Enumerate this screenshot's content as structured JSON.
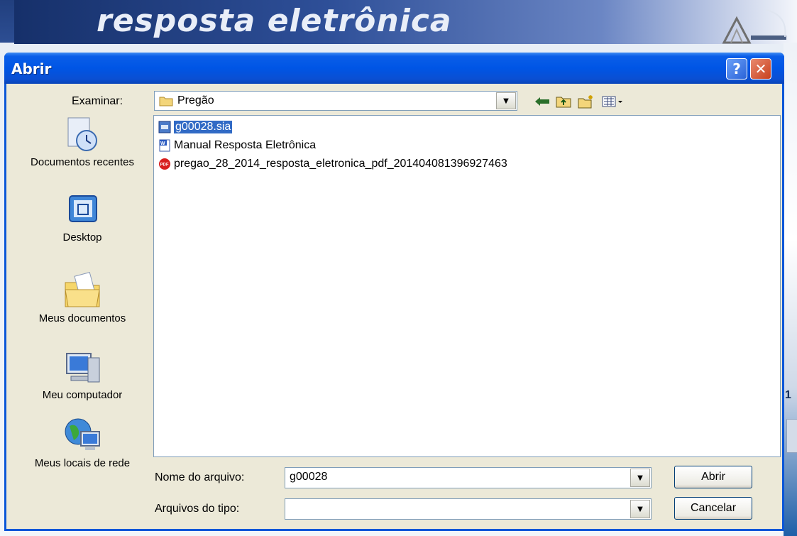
{
  "background": {
    "app_title": "resposta eletrônica",
    "right_label": "1"
  },
  "dialog": {
    "title": "Abrir",
    "help_label": "?",
    "close_label": "✕",
    "look_in_label": "Examinar:",
    "look_in_value": "Pregão",
    "toolbar_icons": [
      "back-arrow-icon",
      "up-folder-icon",
      "new-folder-icon",
      "view-menu-icon"
    ],
    "places": [
      {
        "label": "Documentos recentes",
        "icon": "recent-documents-icon"
      },
      {
        "label": "Desktop",
        "icon": "desktop-icon"
      },
      {
        "label": "Meus documentos",
        "icon": "my-documents-icon"
      },
      {
        "label": "Meu computador",
        "icon": "my-computer-icon"
      },
      {
        "label": "Meus locais de rede",
        "icon": "network-places-icon"
      }
    ],
    "files": [
      {
        "name": "g00028.sia",
        "icon": "sia-file-icon",
        "selected": true
      },
      {
        "name": "Manual Resposta Eletrônica",
        "icon": "word-document-icon",
        "selected": false
      },
      {
        "name": "pregao_28_2014_resposta_eletronica_pdf_201404081396927463",
        "icon": "pdf-file-icon",
        "selected": false
      }
    ],
    "filename_label": "Nome do arquivo:",
    "filename_value": "g00028",
    "filetype_label": "Arquivos do tipo:",
    "filetype_value": "",
    "open_button": "Abrir",
    "cancel_button": "Cancelar"
  }
}
